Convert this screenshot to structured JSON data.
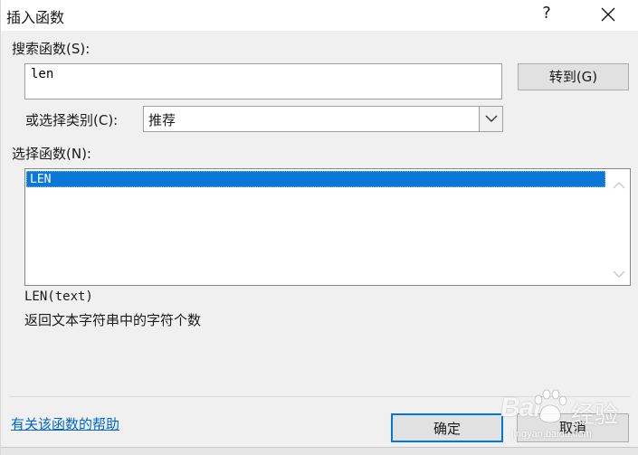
{
  "window": {
    "title": "插入函数",
    "help_glyph": "?",
    "close_icon": "close-icon"
  },
  "search": {
    "label": "搜索函数(S):",
    "value": "len",
    "goto_button": "转到(G)"
  },
  "category": {
    "label": "或选择类别(C):",
    "selected": "推荐",
    "dropdown_icon": "chevron-down-icon"
  },
  "function_list": {
    "label": "选择函数(N):",
    "items": [
      "LEN"
    ],
    "selected_index": 0,
    "selection_color": "#0a78d7"
  },
  "details": {
    "syntax": "LEN(text)",
    "description": "返回文本字符串中的字符个数"
  },
  "footer": {
    "help_link": "有关该函数的帮助",
    "ok_button": "确定",
    "cancel_button": "取消"
  },
  "watermark": {
    "brand": "Bai",
    "suffix": "经验",
    "url": "jingyan.baidu.com"
  }
}
